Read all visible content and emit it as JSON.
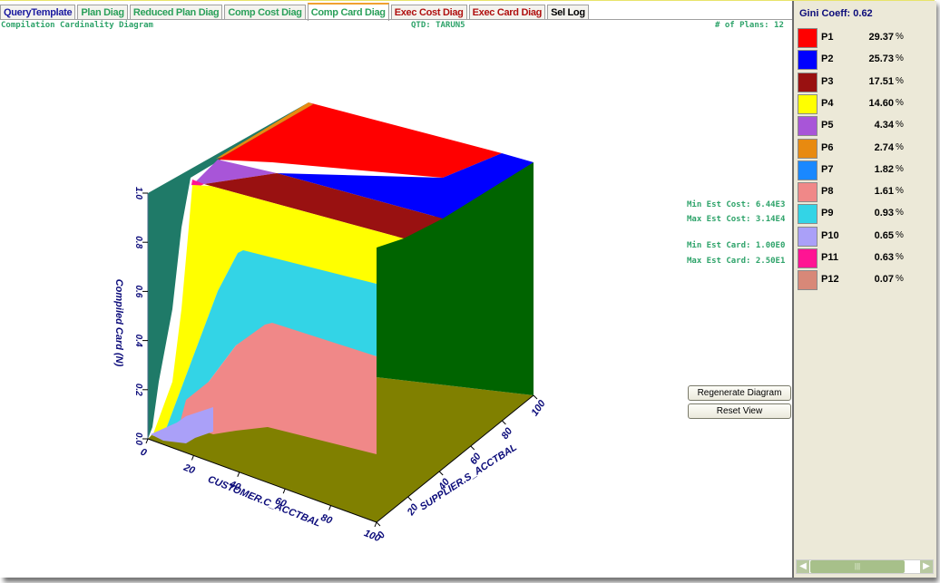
{
  "tabs": [
    {
      "label": "QueryTemplate",
      "color": "#1a1aa0",
      "active": false
    },
    {
      "label": "Plan Diag",
      "color": "#2aa05a",
      "active": false
    },
    {
      "label": "Reduced Plan Diag",
      "color": "#2aa05a",
      "active": false
    },
    {
      "label": "Comp Cost Diag",
      "color": "#2aa05a",
      "active": false
    },
    {
      "label": "Comp Card Diag",
      "color": "#2aa05a",
      "active": true
    },
    {
      "label": "Exec Cost Diag",
      "color": "#b01010",
      "active": false
    },
    {
      "label": "Exec Card Diag",
      "color": "#b01010",
      "active": false
    },
    {
      "label": "Sel Log",
      "color": "#000000",
      "active": false
    }
  ],
  "header": {
    "title": "Compilation Cardinality Diagram",
    "qtd": "QTD: TARUN5",
    "plans": "# of Plans: 12"
  },
  "stats": {
    "min_cost": "Min Est Cost: 6.44E3",
    "max_cost": "Max Est Cost: 3.14E4",
    "min_card": "Min Est Card: 1.00E0",
    "max_card": "Max Est Card: 2.50E1"
  },
  "buttons": {
    "regenerate": "Regenerate Diagram",
    "reset": "Reset View"
  },
  "sidebar": {
    "gini": "Gini Coeff: 0.62",
    "unit": "%",
    "scroll_thumb": "|||"
  },
  "chart_data": {
    "type": "area",
    "title": "Compilation Cardinality Diagram",
    "subtype": "3d-surface-plan-diagram",
    "xlabel": "CUSTOMER.C_ACCTBAL",
    "ylabel": "SUPPLIER.S_ACCTBAL",
    "zlabel": "Compiled Card (N)",
    "x_ticks": [
      "0",
      "20",
      "40",
      "60",
      "80",
      "100"
    ],
    "y_ticks": [
      "0",
      "20",
      "40",
      "60",
      "80",
      "100"
    ],
    "z_ticks": [
      "0.0",
      "0.2",
      "0.4",
      "0.6",
      "0.8",
      "1.0"
    ],
    "xlim": [
      0,
      100
    ],
    "ylim": [
      0,
      100
    ],
    "zlim": [
      0,
      1.0
    ],
    "legend_position": "right",
    "series": [
      {
        "name": "P1",
        "value": 29.37,
        "color": "#ff0000"
      },
      {
        "name": "P2",
        "value": 25.73,
        "color": "#0000ff"
      },
      {
        "name": "P3",
        "value": 17.51,
        "color": "#991111"
      },
      {
        "name": "P4",
        "value": 14.6,
        "color": "#ffff00"
      },
      {
        "name": "P5",
        "value": 4.34,
        "color": "#a855d8"
      },
      {
        "name": "P6",
        "value": 2.74,
        "color": "#e88a10"
      },
      {
        "name": "P7",
        "value": 1.82,
        "color": "#1a88ff"
      },
      {
        "name": "P8",
        "value": 1.61,
        "color": "#f08888"
      },
      {
        "name": "P9",
        "value": 0.93,
        "color": "#33d4e6"
      },
      {
        "name": "P10",
        "value": 0.65,
        "color": "#aaa0f8"
      },
      {
        "name": "P11",
        "value": 0.63,
        "color": "#ff1493"
      },
      {
        "name": "P12",
        "value": 0.07,
        "color": "#d88878"
      }
    ],
    "wall_colors": {
      "left": "#1f7a68",
      "right": "#006400",
      "floor": "#808000"
    }
  }
}
